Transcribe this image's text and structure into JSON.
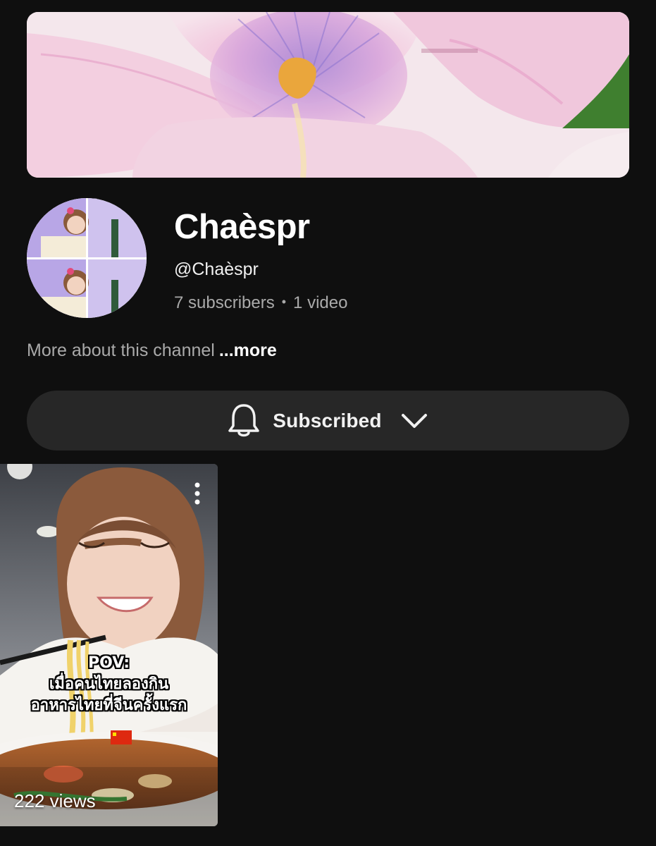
{
  "channel": {
    "name": "Chaèspr",
    "handle": "@Chaèspr",
    "subscribers": "7 subscribers",
    "separator": "•",
    "videos": "1 video"
  },
  "about": {
    "text": "More about this channel",
    "more_label": "...more"
  },
  "subscribe_button": {
    "label": "Subscribed",
    "icon": "bell-icon",
    "dropdown_icon": "chevron-down-icon"
  },
  "shorts": [
    {
      "caption_line1": "POV:",
      "caption_line2": "เมื่อคนไทยลองกิน",
      "caption_line3": "อาหารไทยที่จีนครั้งแรก",
      "views": "222 views",
      "menu_icon": "more-vert-icon"
    }
  ],
  "colors": {
    "background": "#0f0f0f",
    "button_bg": "#272727",
    "secondary_text": "#aaaaaa",
    "primary_text": "#f1f1f1"
  }
}
